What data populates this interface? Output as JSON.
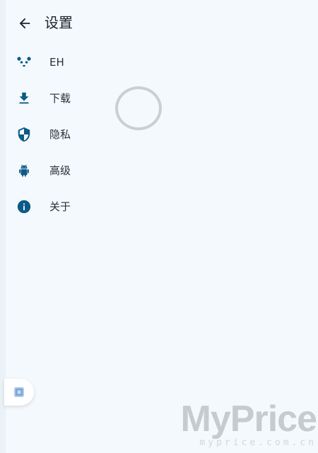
{
  "header": {
    "title": "设置"
  },
  "menu": {
    "items": [
      {
        "label": "EH",
        "icon": "panda-icon"
      },
      {
        "label": "下载",
        "icon": "download-icon"
      },
      {
        "label": "隐私",
        "icon": "shield-icon"
      },
      {
        "label": "高级",
        "icon": "android-icon"
      },
      {
        "label": "关于",
        "icon": "info-icon"
      }
    ]
  },
  "watermark": {
    "brand": "MyPrice",
    "url": "myprice.com.cn"
  },
  "colors": {
    "background": "#f4f9fd",
    "icon_accent": "#0d5a87",
    "spinner": "#c9cbcd"
  }
}
